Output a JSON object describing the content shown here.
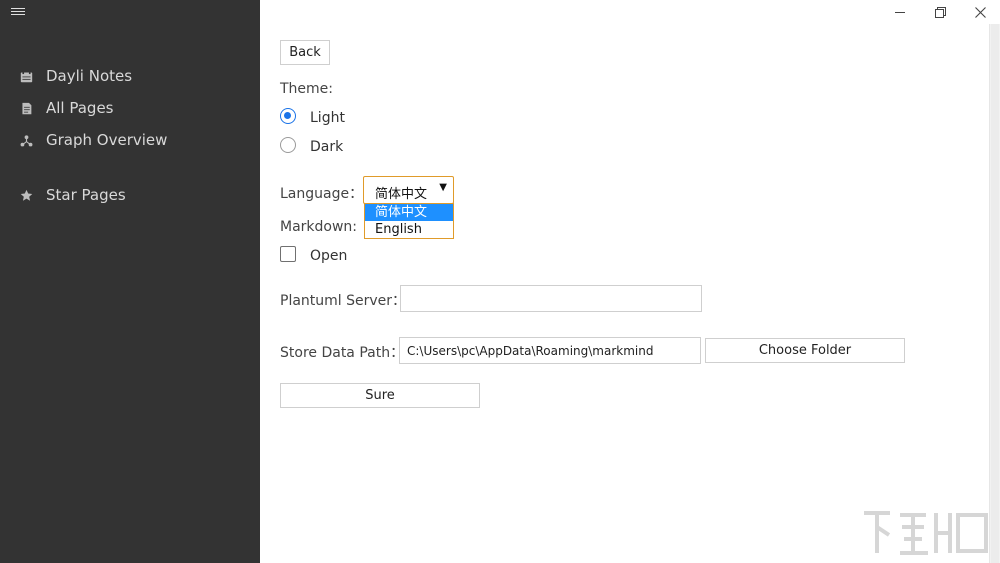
{
  "sidebar": {
    "items": [
      {
        "label": "Dayli Notes",
        "icon": "calendar-icon"
      },
      {
        "label": "All Pages",
        "icon": "pages-icon"
      },
      {
        "label": "Graph Overview",
        "icon": "graph-icon"
      },
      {
        "label": "Star Pages",
        "icon": "star-icon"
      }
    ]
  },
  "window": {
    "minimize": "—",
    "restore": "❐",
    "close": "✕"
  },
  "settings": {
    "back_label": "Back",
    "theme_label": "Theme:",
    "theme_options": [
      {
        "label": "Light",
        "checked": true
      },
      {
        "label": "Dark",
        "checked": false
      }
    ],
    "language_label": "Language：",
    "language_selected": "简体中文",
    "language_options": [
      "简体中文",
      "English"
    ],
    "markdown_label": "Markdown:",
    "markdown_open_label": "Open",
    "markdown_open_checked": false,
    "plantuml_label": "Plantuml Server：",
    "plantuml_value": "",
    "store_path_label": "Store Data Path：",
    "store_path_value": "C:\\Users\\pc\\AppData\\Roaming\\markmind",
    "choose_folder_label": "Choose Folder",
    "sure_label": "Sure"
  },
  "colors": {
    "sidebar_bg": "#333333",
    "accent": "#1a73e8",
    "select_border": "#e09b2a"
  }
}
